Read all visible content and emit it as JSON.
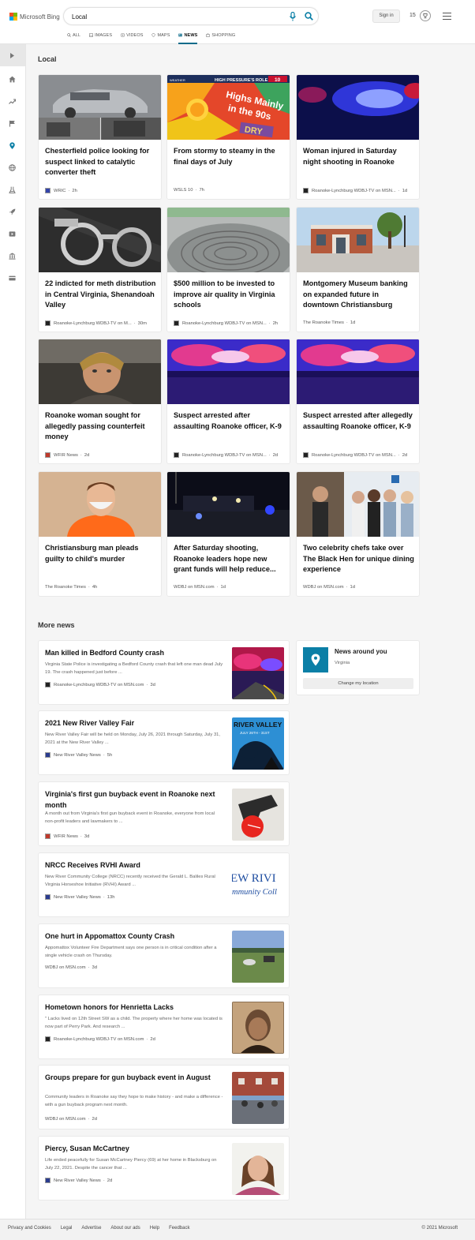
{
  "header": {
    "logo_text": "Microsoft Bing",
    "search_value": "Local",
    "signin_label": "Sign in",
    "rewards_count": "15",
    "logo_colors": [
      "#f25022",
      "#7fba00",
      "#00a4ef",
      "#ffb900"
    ],
    "accent": "#0b6b8a"
  },
  "nav": [
    {
      "label": "ALL",
      "icon": "search-icon"
    },
    {
      "label": "IMAGES",
      "icon": "image-icon"
    },
    {
      "label": "VIDEOS",
      "icon": "video-icon"
    },
    {
      "label": "MAPS",
      "icon": "map-pin-icon"
    },
    {
      "label": "NEWS",
      "icon": "news-icon",
      "active": true
    },
    {
      "label": "SHOPPING",
      "icon": "shopping-bag-icon"
    }
  ],
  "sidebar": [
    "expand-icon",
    "home-icon",
    "trending-icon",
    "flag-icon",
    "location-icon",
    "globe-icon",
    "science-icon",
    "rocket-icon",
    "video-icon",
    "building-icon",
    "card-icon"
  ],
  "local": {
    "heading": "Local",
    "cards": [
      {
        "title": "Chesterfield police looking for suspect linked to catalytic converter theft",
        "source": "WRIC",
        "time": "2h"
      },
      {
        "title": "From stormy to steamy in the final days of July",
        "source": "WSLS 10",
        "time": "7h"
      },
      {
        "title": "Woman injured in Saturday night shooting in Roanoke",
        "source": "Roanoke-Lynchburg WDBJ-TV on MSN...",
        "time": "1d"
      },
      {
        "title": "22 indicted for meth distribution in Central Virginia, Shenandoah Valley",
        "source": "Roanoke-Lynchburg WDBJ-TV on M...",
        "time": "30m"
      },
      {
        "title": "$500 million to be invested to improve air quality in Virginia schools",
        "source": "Roanoke-Lynchburg WDBJ-TV on MSN...",
        "time": "2h"
      },
      {
        "title": "Montgomery Museum banking on expanded future in downtown Christiansburg",
        "source": "The Roanoke Times",
        "time": "1d"
      },
      {
        "title": "Roanoke woman sought for allegedly passing counterfeit money",
        "source": "WFIR News",
        "time": "2d"
      },
      {
        "title": "Suspect arrested after assaulting Roanoke officer, K-9",
        "source": "Roanoke-Lynchburg WDBJ-TV on MSN...",
        "time": "2d"
      },
      {
        "title": "Suspect arrested after allegedly assaulting Roanoke officer, K-9",
        "source": "Roanoke-Lynchburg WDBJ-TV on MSN...",
        "time": "2d"
      },
      {
        "title": "Christiansburg man pleads guilty to child's murder",
        "source": "The Roanoke Times",
        "time": "4h"
      },
      {
        "title": "After Saturday shooting, Roanoke leaders hope new grant funds will help reduce...",
        "source": "WDBJ on MSN.com",
        "time": "1d"
      },
      {
        "title": "Two celebrity chefs take over The Black Hen for unique dining experience",
        "source": "WDBJ on MSN.com",
        "time": "1d"
      }
    ],
    "weather_thumb": {
      "banner": "HIGH PRESSURE'S ROLE",
      "big": "Highs Mainly in the 90s",
      "dry": "DRY",
      "weather_tag": "WEATHER",
      "logo": "10"
    }
  },
  "more_news": {
    "heading": "More news",
    "items": [
      {
        "title": "Man killed in Bedford County crash",
        "snippet": "Virginia State Police is investigating a Bedford County crash that left one man dead July 19. The crash happened just before ...",
        "source": "Roanoke-Lynchburg WDBJ-TV on MSN.com",
        "time": "3d"
      },
      {
        "title": "2021 New River Valley Fair",
        "snippet": "New River Valley Fair will be held on Monday, July 26, 2021 through Saturday, July 31, 2021 at the New River Valley ...",
        "source": "New River Valley News",
        "time": "5h"
      },
      {
        "title": "Virginia's first gun buyback event in Roanoke next month",
        "snippet": "A month out from Virginia's first gun buyback event in Roanoke, everyone from local non-profit leaders and lawmakers to ...",
        "source": "WFIR News",
        "time": "3d"
      },
      {
        "title": "NRCC Receives RVHI Award",
        "snippet": "New River Community College (NRCC) recently received the Gerald L. Baliles Rural Virginia Horseshoe Initiative (RVHI) Award ...",
        "source": "New River Valley News",
        "time": "13h"
      },
      {
        "title": "One hurt in Appomattox County Crash",
        "snippet": "Appomattox Volunteer Fire Department says one person is in critical condition after a single vehicle crash on Thursday.",
        "source": "WDBJ on MSN.com",
        "time": "3d"
      },
      {
        "title": "Hometown honors for Henrietta Lacks",
        "snippet": "\" Lacks lived on 12th Street SW as a child. The property where her home was located is now part of Perry Park. And research ...",
        "source": "Roanoke-Lynchburg WDBJ-TV on MSN.com",
        "time": "2d"
      },
      {
        "title": "Groups prepare for gun buyback event in August",
        "snippet": "Community leaders in Roanoke say they hope to make history - and make a difference - with a gun buyback program next month.",
        "source": "WDBJ on MSN.com",
        "time": "2d"
      },
      {
        "title": "Piercy, Susan McCartney",
        "snippet": "Life ended peacefully for Susan McCartney Piercy (69) at her home in Blacksburg on July 22, 2021. Despite the cancer that ...",
        "source": "New River Valley News",
        "time": "2d"
      }
    ],
    "fair_thumb": {
      "title": "RIVER VALLEY F",
      "date": "JULY 26TH - 31ST"
    },
    "nrcc_thumb": {
      "line1": "EW RIVI",
      "line2": "mmunity Coll"
    }
  },
  "news_around_you": {
    "title": "News around you",
    "location": "Virginia",
    "button": "Change my location"
  },
  "footer": {
    "links": [
      "Privacy and Cookies",
      "Legal",
      "Advertise",
      "About our ads",
      "Help",
      "Feedback"
    ],
    "copyright": "© 2021 Microsoft"
  }
}
